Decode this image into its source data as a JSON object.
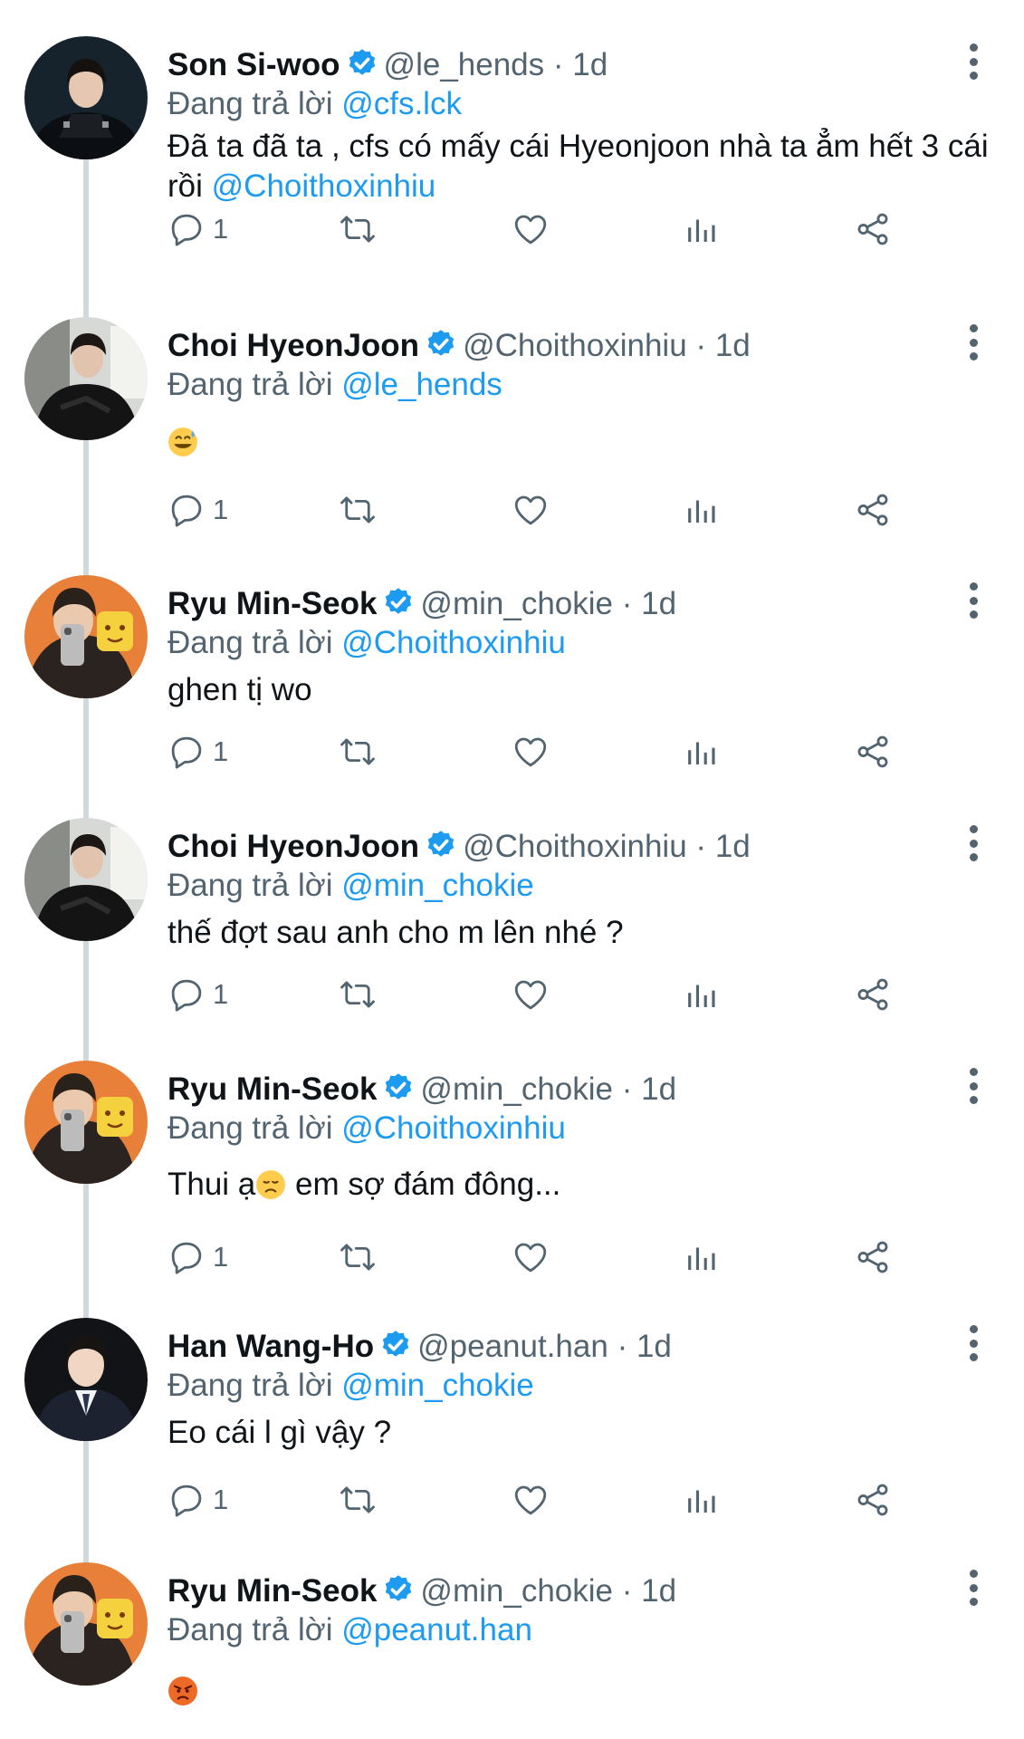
{
  "colors": {
    "accent": "#1d9bf0",
    "secondary_text": "#536471",
    "thread_line": "#cfd9de"
  },
  "icons": {
    "verified": "verified-badge-icon",
    "reply": "reply-icon",
    "retweet": "retweet-icon",
    "like": "like-icon",
    "views": "views-icon",
    "share": "share-icon",
    "more": "more-options-icon"
  },
  "tweets": [
    {
      "name": "Son Si-woo",
      "handle": "@le_hends",
      "dot": "·",
      "time": "1d",
      "reply_prefix": "Đang trả lời",
      "reply_to": "@cfs.lck",
      "text": "Đã ta đã ta , cfs có mấy cái Hyeonjoon nhà ta ẳm hết 3 cái rồi",
      "text_mention": "@Choithoxinhiu",
      "reply_count": "1"
    },
    {
      "name": "Choi HyeonJoon",
      "handle": "@Choithoxinhiu",
      "dot": "·",
      "time": "1d",
      "reply_prefix": "Đang trả lời",
      "reply_to": "@le_hends",
      "emoji": "grinning-sweat-emoji",
      "reply_count": "1"
    },
    {
      "name": "Ryu Min-Seok",
      "handle": "@min_chokie",
      "dot": "·",
      "time": "1d",
      "reply_prefix": "Đang trả lời",
      "reply_to": "@Choithoxinhiu",
      "text": "ghen tị wo",
      "reply_count": "1"
    },
    {
      "name": "Choi HyeonJoon",
      "handle": "@Choithoxinhiu",
      "dot": "·",
      "time": "1d",
      "reply_prefix": "Đang trả lời",
      "reply_to": "@min_chokie",
      "text": "thế đợt sau anh cho m lên nhé ?",
      "reply_count": "1"
    },
    {
      "name": "Ryu Min-Seok",
      "handle": "@min_chokie",
      "dot": "·",
      "time": "1d",
      "reply_prefix": "Đang trả lời",
      "reply_to": "@Choithoxinhiu",
      "text_before": "Thui ạ",
      "emoji": "disappointed-face-emoji",
      "text_after": " em sợ đám đông...",
      "reply_count": "1"
    },
    {
      "name": "Han Wang-Ho",
      "handle": "@peanut.han",
      "dot": "·",
      "time": "1d",
      "reply_prefix": "Đang trả lời",
      "reply_to": "@min_chokie",
      "text": "Eo cái l gì vậy ?",
      "reply_count": "1"
    },
    {
      "name": "Ryu Min-Seok",
      "handle": "@min_chokie",
      "dot": "·",
      "time": "1d",
      "reply_prefix": "Đang trả lời",
      "reply_to": "@peanut.han",
      "emoji": "pouting-face-emoji"
    }
  ]
}
